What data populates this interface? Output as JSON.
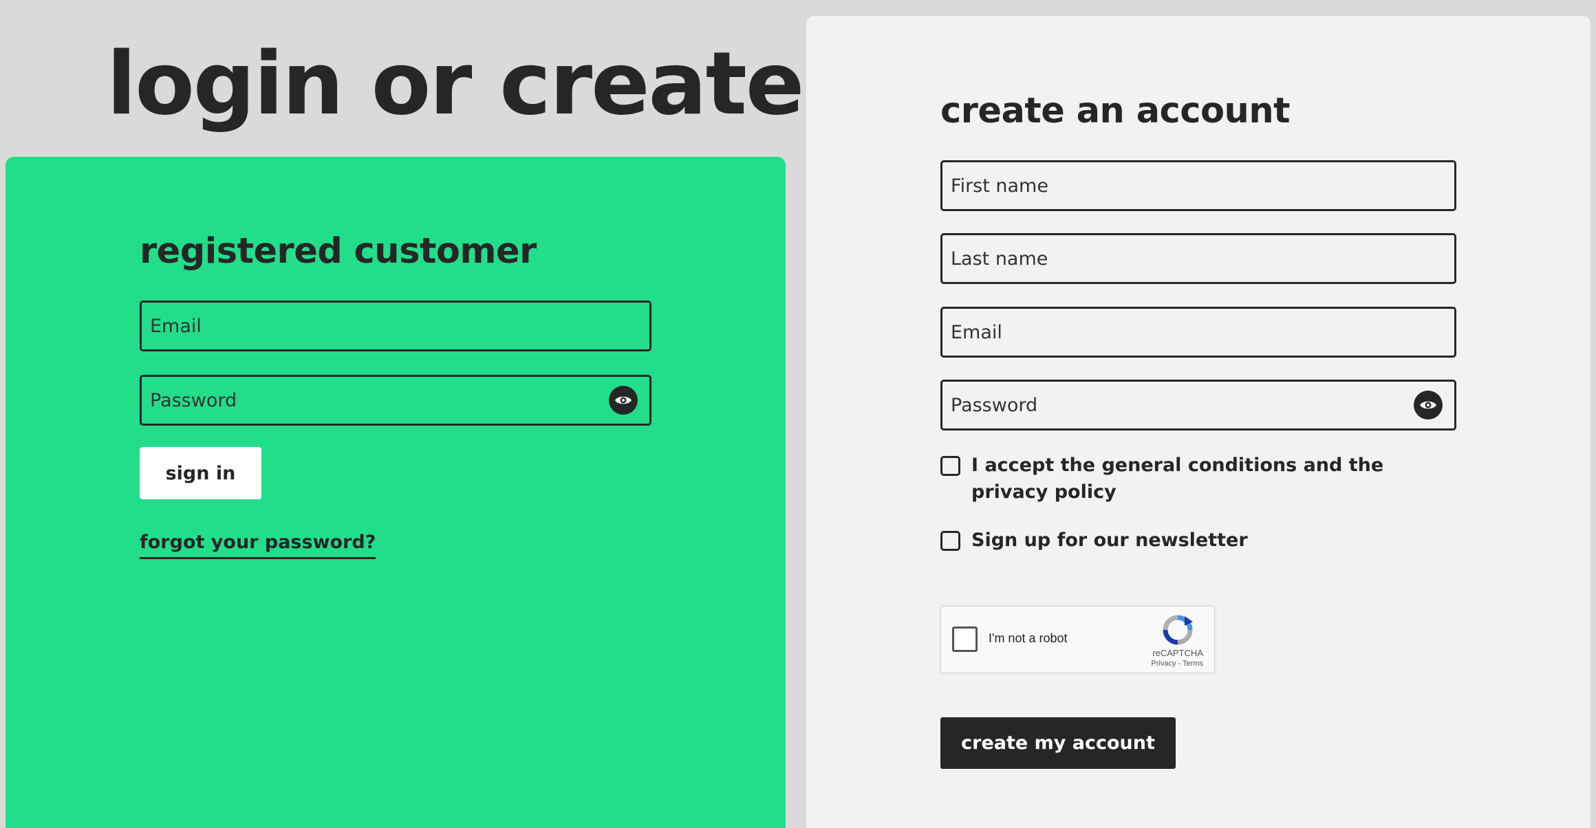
{
  "page": {
    "title": "login or create"
  },
  "login": {
    "heading": "registered customer",
    "email_placeholder": "Email",
    "password_placeholder": "Password",
    "signin_label": "sign in",
    "forgot_label": "forgot your password?"
  },
  "register": {
    "heading": "create an account",
    "first_name_placeholder": "First name",
    "last_name_placeholder": "Last name",
    "email_placeholder": "Email",
    "password_placeholder": "Password",
    "terms_label": "I accept the general conditions and the privacy policy",
    "newsletter_label": "Sign up for our newsletter",
    "submit_label": "create my account"
  },
  "recaptcha": {
    "label": "I'm not a robot",
    "brand": "reCAPTCHA",
    "links": "Privacy - Terms"
  },
  "colors": {
    "accent_green": "#22de8b",
    "dark": "#262626",
    "background": "#dadada",
    "panel_light": "#f2f2f1"
  },
  "icons": [
    "eye-icon",
    "recaptcha-logo-icon"
  ]
}
